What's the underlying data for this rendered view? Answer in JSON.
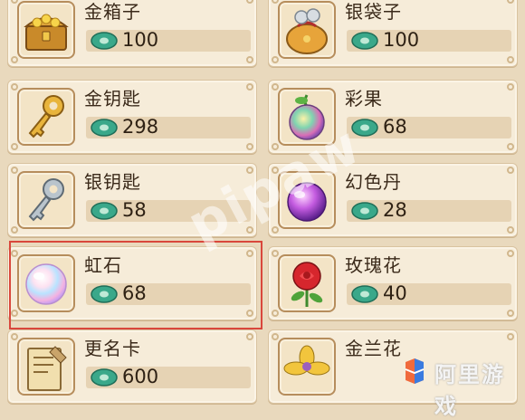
{
  "items": [
    {
      "name": "金箱子",
      "price": "100",
      "icon": "gold-chest-icon"
    },
    {
      "name": "银袋子",
      "price": "100",
      "icon": "silver-bag-icon"
    },
    {
      "name": "金钥匙",
      "price": "298",
      "icon": "gold-key-icon"
    },
    {
      "name": "彩果",
      "price": "68",
      "icon": "rainbow-fruit-icon"
    },
    {
      "name": "银钥匙",
      "price": "58",
      "icon": "silver-key-icon"
    },
    {
      "name": "幻色丹",
      "price": "28",
      "icon": "illusion-pill-icon"
    },
    {
      "name": "虹石",
      "price": "68",
      "icon": "rainbow-stone-icon",
      "selected": true
    },
    {
      "name": "玫瑰花",
      "price": "40",
      "icon": "rose-icon"
    },
    {
      "name": "更名卡",
      "price": "600",
      "icon": "rename-card-icon"
    },
    {
      "name": "金兰花",
      "price": "",
      "icon": "golden-orchid-icon"
    }
  ],
  "currency_icon": "jade-coin-icon",
  "watermark": "pipaw",
  "logo": {
    "text": "阿里游戏",
    "icon": "ali-game-logo-icon"
  },
  "colors": {
    "card_bg": "#f6ecd9",
    "price_bar": "#e6d3b4",
    "highlight": "#d9473c",
    "coin": "#3aa88a"
  }
}
